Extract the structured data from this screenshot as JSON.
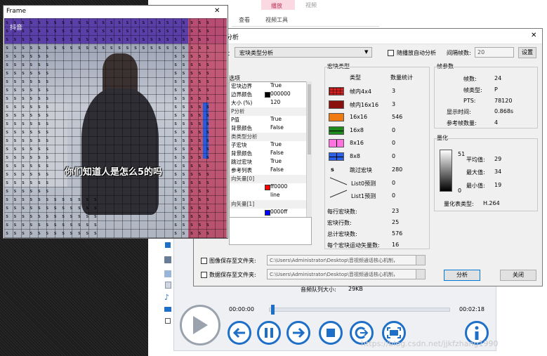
{
  "frame": {
    "title": "Frame",
    "close_glyph": "✕",
    "watermark_brand": "抖音",
    "subtitle": "你们知道人是怎么5的吗"
  },
  "ribbon": {
    "tab_active": "播放",
    "tab_video": "视频",
    "item_view": "查看",
    "item_tools": "视频工具"
  },
  "dialog": {
    "title_fragment": "分析",
    "close_glyph": "✕",
    "analysis_label": "：",
    "analysis_type": "宏块类型分析",
    "auto_analyze_label": "随播放自动分析",
    "interval_label": "间隔帧数:",
    "interval_value": "20",
    "settings_button": "设置",
    "options_header": "选项",
    "props": [
      {
        "k": "宏块边界",
        "v": "True",
        "section": false
      },
      {
        "k": "边界颜色",
        "v": "000000",
        "section": false,
        "swatch": "#000000"
      },
      {
        "k": "大小 (%)",
        "v": "120",
        "section": false
      },
      {
        "k": "P分析",
        "v": "",
        "section": true
      },
      {
        "k": "P值",
        "v": "True",
        "section": false
      },
      {
        "k": "背景颜色",
        "v": "False",
        "section": false
      },
      {
        "k": "类类型分析",
        "v": "",
        "section": true
      },
      {
        "k": "子宏块",
        "v": "True",
        "section": false
      },
      {
        "k": "背景颜色",
        "v": "False",
        "section": false
      },
      {
        "k": "跳过宏块",
        "v": "True",
        "section": false
      },
      {
        "k": "参考列表",
        "v": "False",
        "section": false
      },
      {
        "k": "向矢量[0]",
        "v": "",
        "section": true
      },
      {
        "k": "",
        "v": "ff0000",
        "section": false,
        "swatch": "#ff0000"
      },
      {
        "k": "",
        "v": "line",
        "section": false
      },
      {
        "k": "向矢量[1]",
        "v": "",
        "section": true
      },
      {
        "k": "",
        "v": "0000ff",
        "section": false,
        "swatch": "#0000ff"
      }
    ],
    "mb_types": {
      "header": "宏块类型",
      "col_type": "类型",
      "col_count": "数量统计",
      "rows": [
        {
          "name": "帧内4x4",
          "count": "3",
          "color": "#d22020",
          "pattern": "grid"
        },
        {
          "name": "帧内16x16",
          "count": "3",
          "color": "#8a1010",
          "pattern": "solid"
        },
        {
          "name": "16x16",
          "count": "546",
          "color": "#f07a10",
          "pattern": "solid"
        },
        {
          "name": "16x8",
          "count": "0",
          "color": "#1e8a1e",
          "pattern": "hsplit"
        },
        {
          "name": "8x16",
          "count": "0",
          "color": "#ff70e0",
          "pattern": "vsplit"
        },
        {
          "name": "8x8",
          "count": "0",
          "color": "#2a60e8",
          "pattern": "cross"
        }
      ],
      "skip_symbol": "s",
      "skip_label": "跳过宏块",
      "skip_count": "280",
      "list0_label": "List0预测",
      "list0_count": "0",
      "list1_label": "List1预测",
      "list1_count": "0",
      "per_row_label": "每行宏块数:",
      "per_row": "23",
      "rows_label": "宏块行数:",
      "rows_count": "25",
      "total_label": "总计宏块数:",
      "total": "576",
      "mv_label": "每个宏块运动矢量数:",
      "mv": "16"
    },
    "frame_params": {
      "header": "帧参数",
      "frame_no_label": "帧数:",
      "frame_no": "24",
      "frame_type_label": "帧类型:",
      "frame_type": "P",
      "pts_label": "PTS:",
      "pts": "78120",
      "display_time_label": "显示时间:",
      "display_time": "0.868s",
      "ref_label": "参考帧数量:",
      "ref": "4"
    },
    "quant": {
      "header": "量化",
      "scale_max": "51",
      "scale_min": "0",
      "avg_label": "平均值:",
      "avg": "29",
      "max_label": "最大值:",
      "max": "34",
      "min_label": "最小值:",
      "min": "19",
      "table_label": "量化表类型:",
      "table": "H.264"
    },
    "save_image_label": "图像保存至文件夹:",
    "save_image_path": "C:\\Users\\Administrator\\Desktop\\音视频通话核心机制，",
    "save_data_label": "数据保存至文件夹:",
    "save_data_path": "C:\\Users\\Administrator\\Desktop\\音视频通话核心机制，",
    "analyze_button": "分析",
    "close_button": "关闭"
  },
  "player": {
    "queue_label": "音频队列大小:",
    "queue_value": "29KB",
    "time_current": "00:00:00",
    "time_total": "00:02:18",
    "progress": 0.0
  },
  "watermark": "https://blog.csdn.net/jjkfzhang1990"
}
